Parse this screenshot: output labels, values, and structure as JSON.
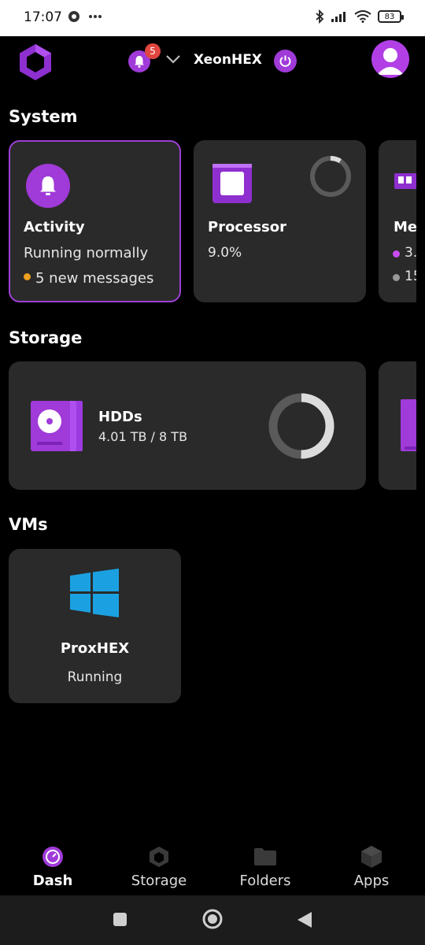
{
  "status_bar": {
    "time": "17:07",
    "battery": "83"
  },
  "header": {
    "host_name": "XeonHEX",
    "notification_count": "5"
  },
  "sections": {
    "system": "System",
    "storage": "Storage",
    "vms": "VMs"
  },
  "system_cards": {
    "activity": {
      "title": "Activity",
      "status": "Running normally",
      "messages": "5 new messages",
      "dot_color": "#f0a020"
    },
    "processor": {
      "title": "Processor",
      "usage": "9.0%",
      "usage_fraction": 0.09
    },
    "memory": {
      "title": "Me",
      "line1": "3.",
      "line2": "15"
    }
  },
  "storage_cards": {
    "hdds": {
      "title": "HDDs",
      "usage": "4.01 TB / 8 TB",
      "used_fraction": 0.501
    }
  },
  "vm_cards": [
    {
      "name": "ProxHEX",
      "status": "Running"
    }
  ],
  "bottom_nav": [
    {
      "label": "Dash",
      "active": true
    },
    {
      "label": "Storage",
      "active": false
    },
    {
      "label": "Folders",
      "active": false
    },
    {
      "label": "Apps",
      "active": false
    }
  ],
  "colors": {
    "accent": "#a03ad8",
    "card_bg": "#2a2a2a",
    "badge": "#e0463f",
    "windows_blue": "#1ba1e2"
  }
}
